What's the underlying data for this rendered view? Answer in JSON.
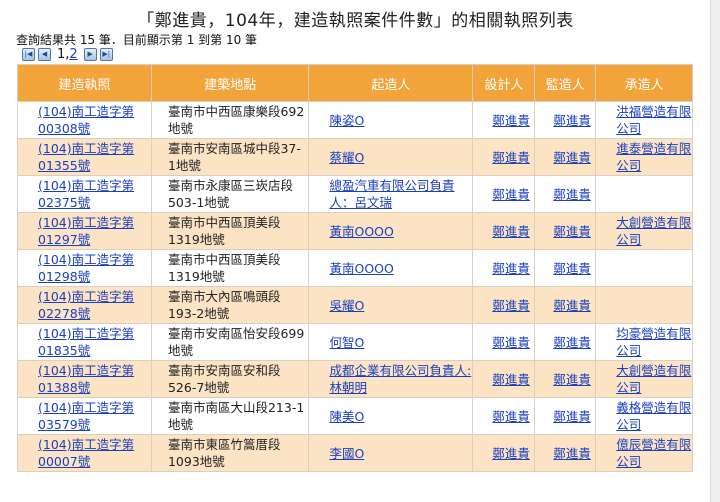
{
  "title": "「鄭進貴，104年，建造執照案件件數」的相關執照列表",
  "summary": "查詢結果共 15 筆．目前顯示第 1 到第 10 筆",
  "pager": {
    "first_icon": "first-page-icon",
    "prev_icon": "prev-page-icon",
    "next_icon": "next-page-icon",
    "last_icon": "last-page-icon",
    "current_page": "1",
    "separator": ",",
    "other_page": "2"
  },
  "columns": [
    "建造執照",
    "建築地點",
    "起造人",
    "設計人",
    "監造人",
    "承造人"
  ],
  "rows": [
    {
      "license": "(104)南工造字第00308號",
      "location": "臺南市中西區康樂段692地號",
      "owner": "陳姿O",
      "designer": "鄭進貴",
      "supervisor": "鄭進貴",
      "contractor": "洪福營造有限公司"
    },
    {
      "license": "(104)南工造字第01355號",
      "location": "臺南市安南區城中段37-1地號",
      "owner": "蔡耀O",
      "designer": "鄭進貴",
      "supervisor": "鄭進貴",
      "contractor": "進泰營造有限公司"
    },
    {
      "license": "(104)南工造字第02375號",
      "location": "臺南市永康區三崁店段503-1地號",
      "owner": "總盈汽車有限公司負責人：呂文瑞",
      "designer": "鄭進貴",
      "supervisor": "鄭進貴",
      "contractor": ""
    },
    {
      "license": "(104)南工造字第01297號",
      "location": "臺南市中西區頂美段1319地號",
      "owner": "黃南OOOO",
      "designer": "鄭進貴",
      "supervisor": "鄭進貴",
      "contractor": "大創營造有限公司"
    },
    {
      "license": "(104)南工造字第01298號",
      "location": "臺南市中西區頂美段1319地號",
      "owner": "黃南OOOO",
      "designer": "鄭進貴",
      "supervisor": "鄭進貴",
      "contractor": ""
    },
    {
      "license": "(104)南工造字第02278號",
      "location": "臺南市大內區鳴頭段193-2地號",
      "owner": "吳耀O",
      "designer": "鄭進貴",
      "supervisor": "鄭進貴",
      "contractor": ""
    },
    {
      "license": "(104)南工造字第01835號",
      "location": "臺南市安南區怡安段699地號",
      "owner": "何智O",
      "designer": "鄭進貴",
      "supervisor": "鄭進貴",
      "contractor": "均豪營造有限公司"
    },
    {
      "license": "(104)南工造字第01388號",
      "location": "臺南市安南區安和段526-7地號",
      "owner": "成都企業有限公司負責人:林朝明",
      "designer": "鄭進貴",
      "supervisor": "鄭進貴",
      "contractor": "大創營造有限公司"
    },
    {
      "license": "(104)南工造字第03579號",
      "location": "臺南市南區大山段213-1地號",
      "owner": "陳美O",
      "designer": "鄭進貴",
      "supervisor": "鄭進貴",
      "contractor": "義格營造有限公司"
    },
    {
      "license": "(104)南工造字第00007號",
      "location": "臺南市東區竹篙厝段1093地號",
      "owner": "李國O",
      "designer": "鄭進貴",
      "supervisor": "鄭進貴",
      "contractor": "億辰營造有限公司"
    }
  ],
  "colors": {
    "header_bg": "#f2a33a",
    "alt_row_bg": "#fbe3c4",
    "link": "#1a3fc0"
  }
}
